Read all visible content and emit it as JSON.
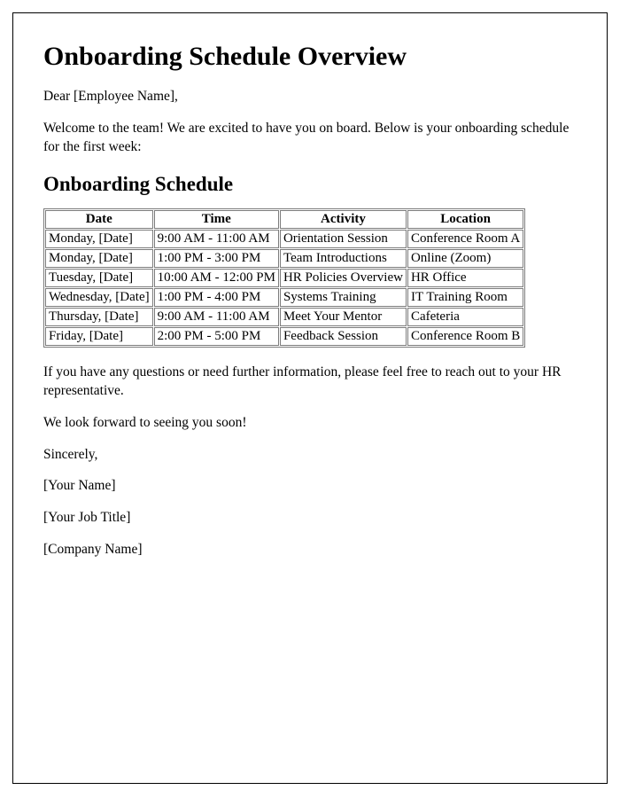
{
  "title": "Onboarding Schedule Overview",
  "greeting": "Dear [Employee Name],",
  "intro": "Welcome to the team! We are excited to have you on board. Below is your onboarding schedule for the first week:",
  "section_heading": "Onboarding Schedule",
  "table": {
    "headers": [
      "Date",
      "Time",
      "Activity",
      "Location"
    ],
    "rows": [
      {
        "date": "Monday, [Date]",
        "time": "9:00 AM - 11:00 AM",
        "activity": "Orientation Session",
        "location": "Conference Room A"
      },
      {
        "date": "Monday, [Date]",
        "time": "1:00 PM - 3:00 PM",
        "activity": "Team Introductions",
        "location": "Online (Zoom)"
      },
      {
        "date": "Tuesday, [Date]",
        "time": "10:00 AM - 12:00 PM",
        "activity": "HR Policies Overview",
        "location": "HR Office"
      },
      {
        "date": "Wednesday, [Date]",
        "time": "1:00 PM - 4:00 PM",
        "activity": "Systems Training",
        "location": "IT Training Room"
      },
      {
        "date": "Thursday, [Date]",
        "time": "9:00 AM - 11:00 AM",
        "activity": "Meet Your Mentor",
        "location": "Cafeteria"
      },
      {
        "date": "Friday, [Date]",
        "time": "2:00 PM - 5:00 PM",
        "activity": "Feedback Session",
        "location": "Conference Room B"
      }
    ]
  },
  "closing_1": "If you have any questions or need further information, please feel free to reach out to your HR representative.",
  "closing_2": "We look forward to seeing you soon!",
  "signoff": "Sincerely,",
  "signer_name": "[Your Name]",
  "signer_title": "[Your Job Title]",
  "company": "[Company Name]"
}
